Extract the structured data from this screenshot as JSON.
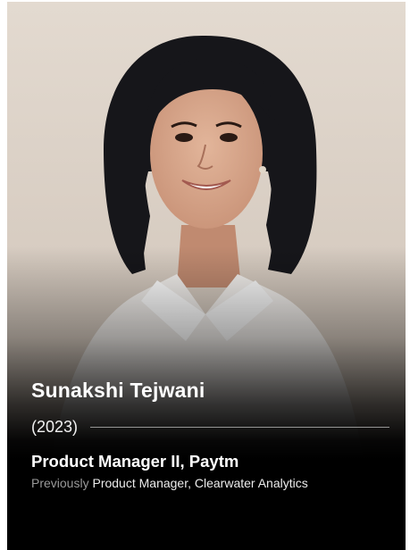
{
  "profile": {
    "name": "Sunakshi Tejwani",
    "year": "(2023)",
    "current_role": "Product Manager II, Paytm",
    "previous_prefix": "Previously",
    "previous_role": "Product Manager, Clearwater Analytics"
  },
  "colors": {
    "card_background": "#d9cfc5",
    "text_primary": "#ffffff",
    "text_muted": "#9a9a9a",
    "overlay": "#000000"
  }
}
